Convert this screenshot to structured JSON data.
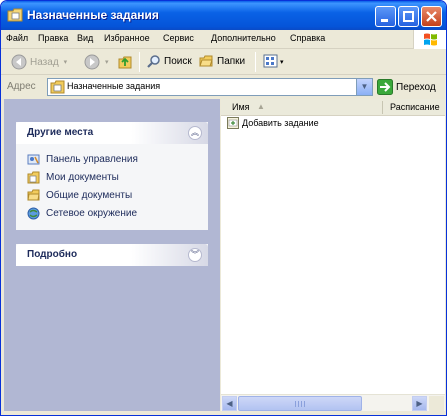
{
  "window": {
    "title": "Назначенные задания"
  },
  "menu": {
    "items": [
      "Файл",
      "Правка",
      "Вид",
      "Избранное",
      "Сервис",
      "Дополнительно",
      "Справка"
    ]
  },
  "toolbar": {
    "back_label": "Назад",
    "search_label": "Поиск",
    "folders_label": "Папки"
  },
  "address": {
    "label": "Адрес",
    "value": "Назначенные задания",
    "go_label": "Переход"
  },
  "left_pane": {
    "other_places": {
      "title": "Другие места",
      "items": [
        {
          "label": "Панель управления",
          "icon": "control-panel-icon"
        },
        {
          "label": "Мои документы",
          "icon": "my-documents-icon"
        },
        {
          "label": "Общие документы",
          "icon": "shared-documents-icon"
        },
        {
          "label": "Сетевое окружение",
          "icon": "network-places-icon"
        }
      ]
    },
    "details": {
      "title": "Подробно"
    }
  },
  "list": {
    "columns": [
      "Имя",
      "Расписание"
    ],
    "items": [
      {
        "label": "Добавить задание",
        "icon": "add-task-icon"
      }
    ]
  },
  "colors": {
    "title_bar": "#0554d8",
    "left_pane_bg": "#b1b7d3",
    "panel_text": "#1c2a5a"
  }
}
